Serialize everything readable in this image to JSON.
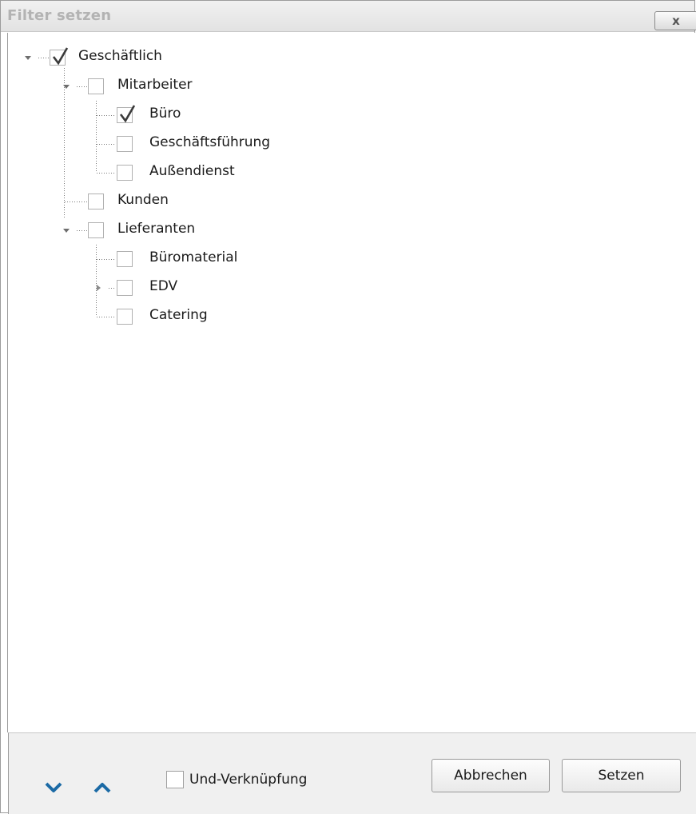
{
  "window": {
    "title": "Filter setzen",
    "close_glyph": "x",
    "close_icon": "close-icon"
  },
  "tree": {
    "items": [
      {
        "label": "Geschäftlich",
        "checked": true,
        "expanded": true
      },
      {
        "label": "Mitarbeiter",
        "checked": false,
        "expanded": true
      },
      {
        "label": "Büro",
        "checked": true
      },
      {
        "label": "Geschäftsführung",
        "checked": false
      },
      {
        "label": "Außendienst",
        "checked": false
      },
      {
        "label": "Kunden",
        "checked": false
      },
      {
        "label": "Lieferanten",
        "checked": false,
        "expanded": true
      },
      {
        "label": "Büromaterial",
        "checked": false
      },
      {
        "label": "EDV",
        "checked": false,
        "expanded": false
      },
      {
        "label": "Catering",
        "checked": false
      }
    ]
  },
  "footer": {
    "down_icon": "chevron-down-icon",
    "up_icon": "chevron-up-icon",
    "und_label": "Und-Verknüpfung",
    "und_checked": false,
    "cancel_label": "Abbrechen",
    "apply_label": "Setzen"
  },
  "colors": {
    "accent": "#1b6aa5",
    "title_text": "#b3b3b3",
    "footer_bg": "#f0f0f0"
  }
}
